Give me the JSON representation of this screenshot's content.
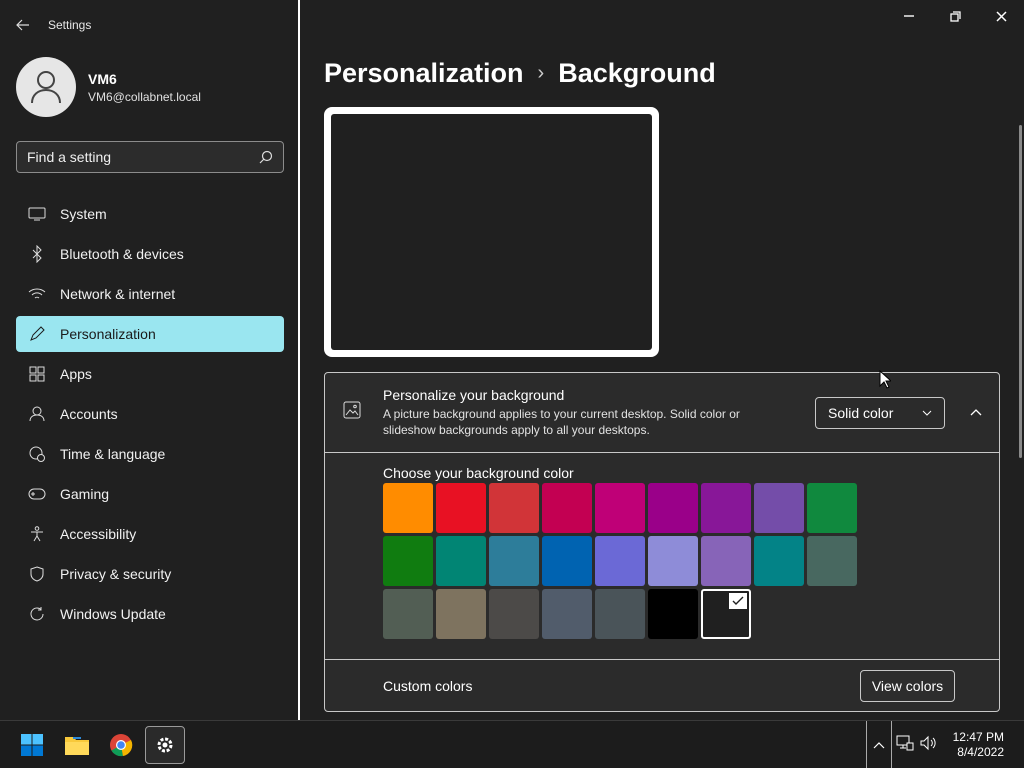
{
  "window": {
    "title": "Settings",
    "controls": [
      "minimize",
      "restore",
      "close"
    ]
  },
  "profile": {
    "name": "VM6",
    "email": "VM6@collabnet.local"
  },
  "search": {
    "placeholder": "Find a setting",
    "icon": "search-icon"
  },
  "sidebar": {
    "items": [
      {
        "label": "System",
        "icon": "monitor-icon",
        "active": false
      },
      {
        "label": "Bluetooth & devices",
        "icon": "bluetooth-icon",
        "active": false
      },
      {
        "label": "Network & internet",
        "icon": "wifi-icon",
        "active": false
      },
      {
        "label": "Personalization",
        "icon": "pen-icon",
        "active": true
      },
      {
        "label": "Apps",
        "icon": "apps-icon",
        "active": false
      },
      {
        "label": "Accounts",
        "icon": "person-icon",
        "active": false
      },
      {
        "label": "Time & language",
        "icon": "globe-clock-icon",
        "active": false
      },
      {
        "label": "Gaming",
        "icon": "gamepad-icon",
        "active": false
      },
      {
        "label": "Accessibility",
        "icon": "accessibility-icon",
        "active": false
      },
      {
        "label": "Privacy & security",
        "icon": "shield-icon",
        "active": false
      },
      {
        "label": "Windows Update",
        "icon": "update-icon",
        "active": false
      }
    ],
    "accent": "#9ae6f0"
  },
  "breadcrumb": {
    "parent": "Personalization",
    "separator": "›",
    "current": "Background"
  },
  "background_card": {
    "title": "Personalize your background",
    "description": "A picture background applies to your current desktop. Solid color or slideshow backgrounds apply to all your desktops.",
    "dropdown_value": "Solid color",
    "expanded": true
  },
  "color_picker": {
    "title": "Choose your background color",
    "colors": [
      "#ff8c00",
      "#e81123",
      "#d13438",
      "#c30052",
      "#bf0077",
      "#9a0089",
      "#881798",
      "#744da9",
      "#10893e",
      "#107c10",
      "#018574",
      "#2d7d9a",
      "#0063b1",
      "#6b69d6",
      "#8e8cd8",
      "#8764b8",
      "#038387",
      "#486860",
      "#525e54",
      "#7e735f",
      "#4c4a48",
      "#515c6b",
      "#4a5459",
      "#000000",
      "#202020"
    ],
    "selected_index": 24
  },
  "custom_colors": {
    "label": "Custom colors",
    "button": "View colors"
  },
  "taskbar": {
    "apps": [
      "windows-start-icon",
      "file-explorer-icon",
      "chrome-icon",
      "settings-gear-icon"
    ],
    "active_app": "settings-gear-icon",
    "time": "12:47 PM",
    "date": "8/4/2022"
  }
}
